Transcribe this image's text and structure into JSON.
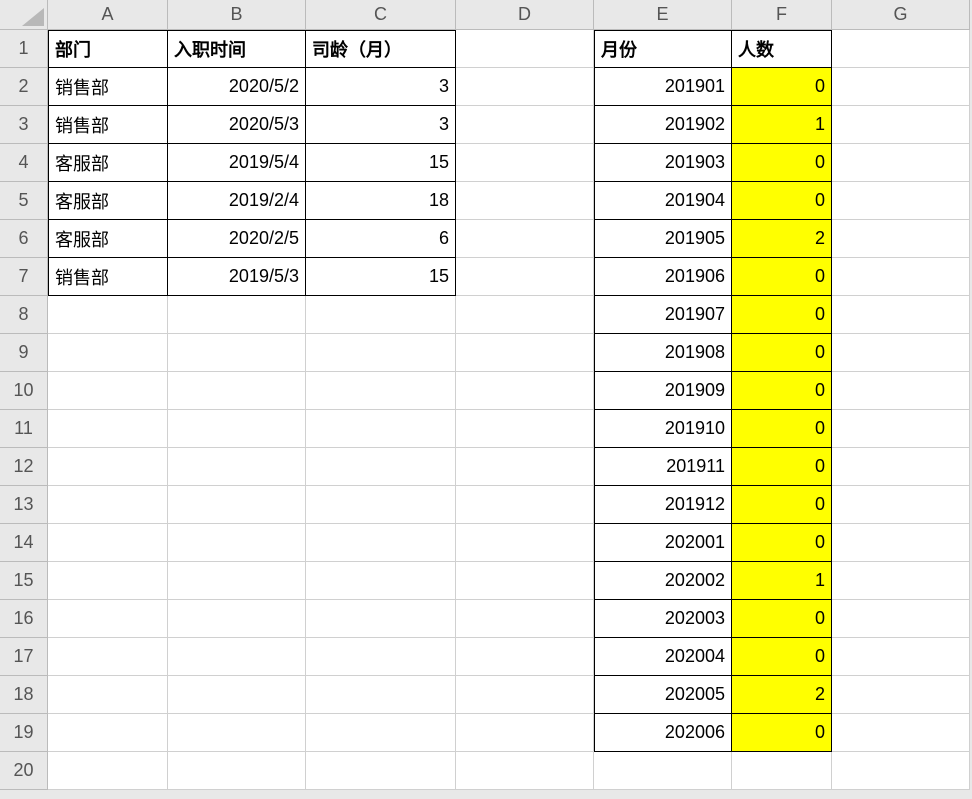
{
  "colHeaders": [
    "A",
    "B",
    "C",
    "D",
    "E",
    "F",
    "G"
  ],
  "rowHeaders": [
    "1",
    "2",
    "3",
    "4",
    "5",
    "6",
    "7",
    "8",
    "9",
    "10",
    "11",
    "12",
    "13",
    "14",
    "15",
    "16",
    "17",
    "18",
    "19",
    "20"
  ],
  "table1": {
    "header": {
      "dept": "部门",
      "hireDate": "入职时间",
      "tenure": "司龄（月）"
    },
    "rows": [
      {
        "dept": "销售部",
        "hireDate": "2020/5/2",
        "tenure": "3"
      },
      {
        "dept": "销售部",
        "hireDate": "2020/5/3",
        "tenure": "3"
      },
      {
        "dept": "客服部",
        "hireDate": "2019/5/4",
        "tenure": "15"
      },
      {
        "dept": "客服部",
        "hireDate": "2019/2/4",
        "tenure": "18"
      },
      {
        "dept": "客服部",
        "hireDate": "2020/2/5",
        "tenure": "6"
      },
      {
        "dept": "销售部",
        "hireDate": "2019/5/3",
        "tenure": "15"
      }
    ]
  },
  "table2": {
    "header": {
      "month": "月份",
      "count": "人数"
    },
    "rows": [
      {
        "month": "201901",
        "count": "0"
      },
      {
        "month": "201902",
        "count": "1"
      },
      {
        "month": "201903",
        "count": "0"
      },
      {
        "month": "201904",
        "count": "0"
      },
      {
        "month": "201905",
        "count": "2"
      },
      {
        "month": "201906",
        "count": "0"
      },
      {
        "month": "201907",
        "count": "0"
      },
      {
        "month": "201908",
        "count": "0"
      },
      {
        "month": "201909",
        "count": "0"
      },
      {
        "month": "201910",
        "count": "0"
      },
      {
        "month": "201911",
        "count": "0"
      },
      {
        "month": "201912",
        "count": "0"
      },
      {
        "month": "202001",
        "count": "0"
      },
      {
        "month": "202002",
        "count": "1"
      },
      {
        "month": "202003",
        "count": "0"
      },
      {
        "month": "202004",
        "count": "0"
      },
      {
        "month": "202005",
        "count": "2"
      },
      {
        "month": "202006",
        "count": "0"
      }
    ]
  }
}
